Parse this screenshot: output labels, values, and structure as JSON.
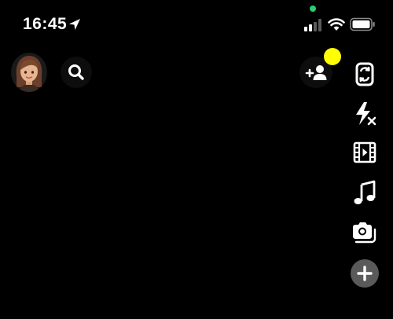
{
  "status_bar": {
    "time": "16:45",
    "icons": [
      "location-arrow-icon",
      "signal-icon",
      "wifi-icon",
      "battery-icon"
    ],
    "privacy_indicator_color": "#2ecc71"
  },
  "top_bar": {
    "avatar_icon": "bitmoji-avatar-icon",
    "search_icon": "search-icon",
    "add_friend_icon": "add-friend-icon",
    "notification_dot_color": "#ffff00"
  },
  "toolbar": {
    "items": [
      {
        "name": "flip-camera",
        "icon": "flip-camera-icon"
      },
      {
        "name": "flash-off",
        "icon": "flash-off-icon"
      },
      {
        "name": "video-mode",
        "icon": "film-strip-icon"
      },
      {
        "name": "music",
        "icon": "music-note-icon"
      },
      {
        "name": "dual-camera",
        "icon": "camera-stack-icon"
      },
      {
        "name": "more",
        "icon": "plus-icon"
      }
    ]
  },
  "colors": {
    "background": "#000000",
    "icon": "#ffffff",
    "add_button_bg": "#5a5a5a"
  }
}
